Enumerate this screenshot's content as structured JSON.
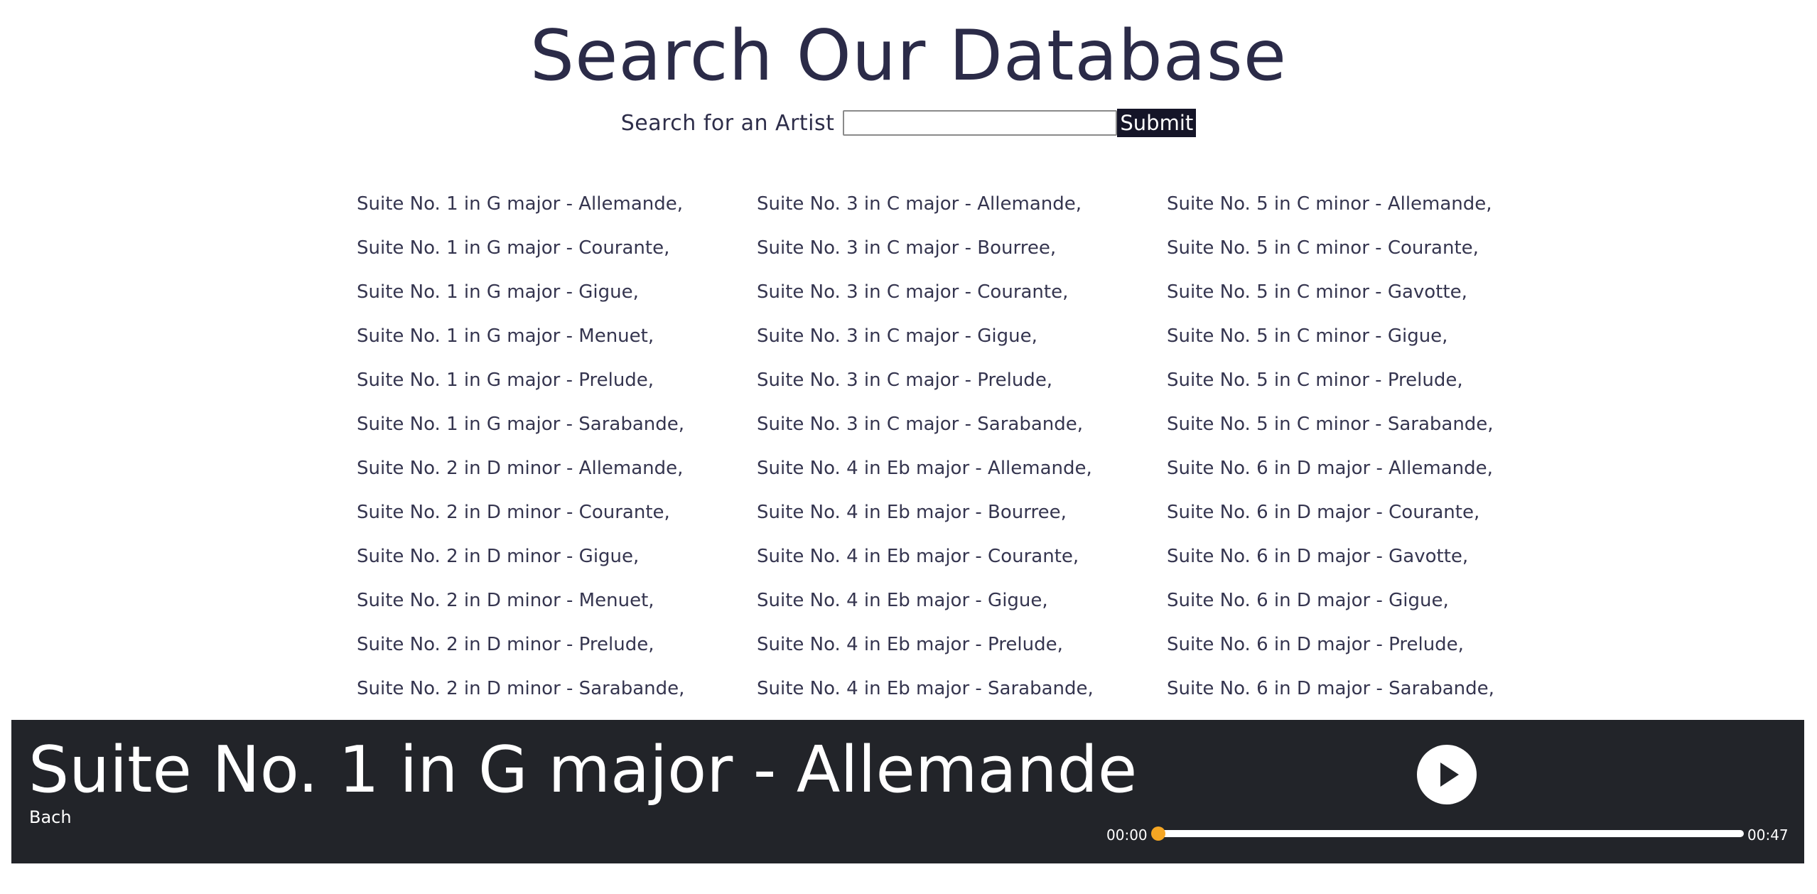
{
  "header": {
    "title": "Search Our Database"
  },
  "search": {
    "label": "Search for an Artist",
    "value": "",
    "placeholder": "",
    "submit_label": "Submit"
  },
  "tracks": {
    "col1": [
      "Suite No. 1 in G major - Allemande,",
      "Suite No. 1 in G major - Courante,",
      "Suite No. 1 in G major - Gigue,",
      "Suite No. 1 in G major - Menuet,",
      "Suite No. 1 in G major - Prelude,",
      "Suite No. 1 in G major - Sarabande,",
      "Suite No. 2 in D minor - Allemande,",
      "Suite No. 2 in D minor - Courante,",
      "Suite No. 2 in D minor - Gigue,",
      "Suite No. 2 in D minor - Menuet,",
      "Suite No. 2 in D minor - Prelude,",
      "Suite No. 2 in D minor - Sarabande,"
    ],
    "col2": [
      "Suite No. 3 in C major - Allemande,",
      "Suite No. 3 in C major - Bourree,",
      "Suite No. 3 in C major - Courante,",
      "Suite No. 3 in C major - Gigue,",
      "Suite No. 3 in C major - Prelude,",
      "Suite No. 3 in C major - Sarabande,",
      "Suite No. 4 in Eb major - Allemande,",
      "Suite No. 4 in Eb major - Bourree,",
      "Suite No. 4 in Eb major - Courante,",
      "Suite No. 4 in Eb major - Gigue,",
      "Suite No. 4 in Eb major - Prelude,",
      "Suite No. 4 in Eb major - Sarabande,"
    ],
    "col3": [
      "Suite No. 5 in C minor - Allemande,",
      "Suite No. 5 in C minor - Courante,",
      "Suite No. 5 in C minor - Gavotte,",
      "Suite No. 5 in C minor - Gigue,",
      "Suite No. 5 in C minor - Prelude,",
      "Suite No. 5 in C minor - Sarabande,",
      "Suite No. 6 in D major - Allemande,",
      "Suite No. 6 in D major - Courante,",
      "Suite No. 6 in D major - Gavotte,",
      "Suite No. 6 in D major - Gigue,",
      "Suite No. 6 in D major - Prelude,",
      "Suite No. 6 in D major - Sarabande,"
    ]
  },
  "player": {
    "title": "Suite No. 1 in G major - Allemande",
    "artist": "Bach",
    "play_icon": "play-icon",
    "current_time": "00:00",
    "total_time": "00:47",
    "progress": 0,
    "accent_color": "#f5a623",
    "background_color": "#222429"
  }
}
